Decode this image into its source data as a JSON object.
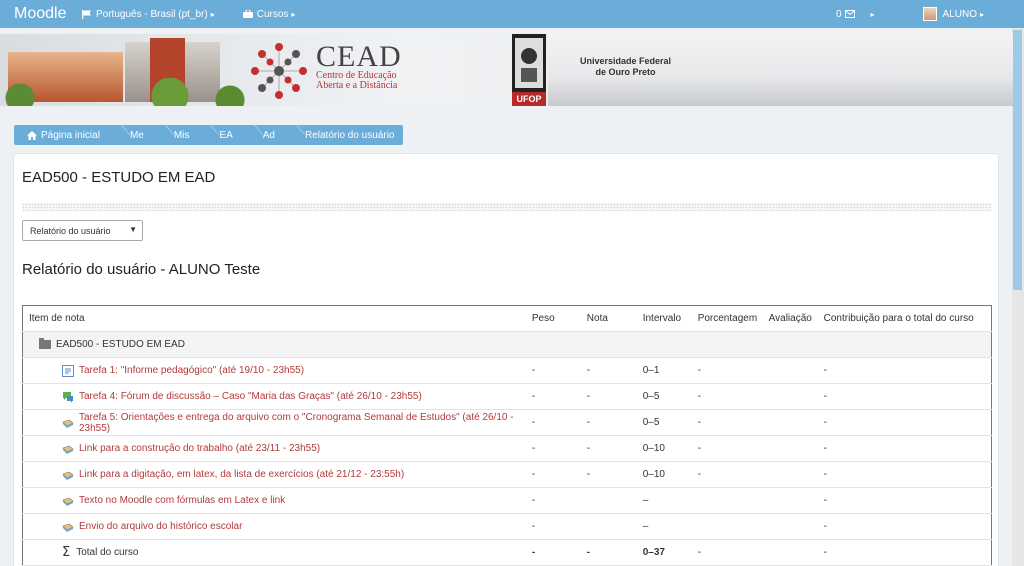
{
  "navbar": {
    "brand": "Moodle",
    "language": "Português - Brasil (pt_br)",
    "courses": "Cursos",
    "messages_count": "0",
    "user": "ALUNO"
  },
  "banner": {
    "cead_title": "CEAD",
    "cead_sub1": "Centro de Educação",
    "cead_sub2": "Aberta e a Distância",
    "ufop_label": "UFOP",
    "university_line1": "Universidade Federal",
    "university_line2": "de Ouro Preto"
  },
  "breadcrumb": [
    "Página inicial",
    "Me",
    "Mis",
    "EA",
    "Ad",
    "Relatório do usuário"
  ],
  "course_title": "EAD500 - ESTUDO EM EAD",
  "report_select": {
    "value": "Relatório do usuário"
  },
  "report_title": "Relatório do usuário - ALUNO Teste",
  "table": {
    "headers": [
      "Item de nota",
      "Peso",
      "Nota",
      "Intervalo",
      "Porcentagem",
      "Avaliação",
      "Contribuição para o total do curso"
    ],
    "category": "EAD500 - ESTUDO EM EAD",
    "rows": [
      {
        "icon": "assignment-icon",
        "name": "Tarefa 1: \"Informe pedagógico\" (até 19/10 - 23h55)",
        "peso": "-",
        "nota": "-",
        "intervalo": "0–1",
        "porcentagem": "-",
        "avaliacao": "",
        "contribuicao": "-"
      },
      {
        "icon": "forum-icon",
        "name": "Tarefa 4: Fórum de discussão – Caso \"Maria das Graças\" (até 26/10 - 23h55)",
        "peso": "-",
        "nota": "-",
        "intervalo": "0–5",
        "porcentagem": "-",
        "avaliacao": "",
        "contribuicao": "-"
      },
      {
        "icon": "upload-icon",
        "name": "Tarefa 5: Orientações e entrega do arquivo com o \"Cronograma Semanal de Estudos\" (até 26/10 - 23h55)",
        "peso": "-",
        "nota": "-",
        "intervalo": "0–5",
        "porcentagem": "-",
        "avaliacao": "",
        "contribuicao": "-"
      },
      {
        "icon": "upload-icon",
        "name": "Link para a construção do trabalho (até 23/11 - 23h55)",
        "peso": "-",
        "nota": "-",
        "intervalo": "0–10",
        "porcentagem": "-",
        "avaliacao": "",
        "contribuicao": "-"
      },
      {
        "icon": "upload-icon",
        "name": "Link para a digitação, em latex, da lista de exercícios (até 21/12 - 23:55h)",
        "peso": "-",
        "nota": "-",
        "intervalo": "0–10",
        "porcentagem": "-",
        "avaliacao": "",
        "contribuicao": "-"
      },
      {
        "icon": "upload-icon",
        "name": "Texto no Moodle com fórmulas em Latex e link",
        "peso": "-",
        "nota": "",
        "intervalo": "–",
        "porcentagem": "",
        "avaliacao": "",
        "contribuicao": "-"
      },
      {
        "icon": "upload-icon",
        "name": "Envio do arquivo do histórico escolar",
        "peso": "-",
        "nota": "",
        "intervalo": "–",
        "porcentagem": "",
        "avaliacao": "",
        "contribuicao": "-"
      }
    ],
    "total": {
      "name": "Total do curso",
      "peso": "-",
      "nota": "-",
      "intervalo": "0–37",
      "porcentagem": "-",
      "avaliacao": "",
      "contribuicao": "-"
    }
  }
}
